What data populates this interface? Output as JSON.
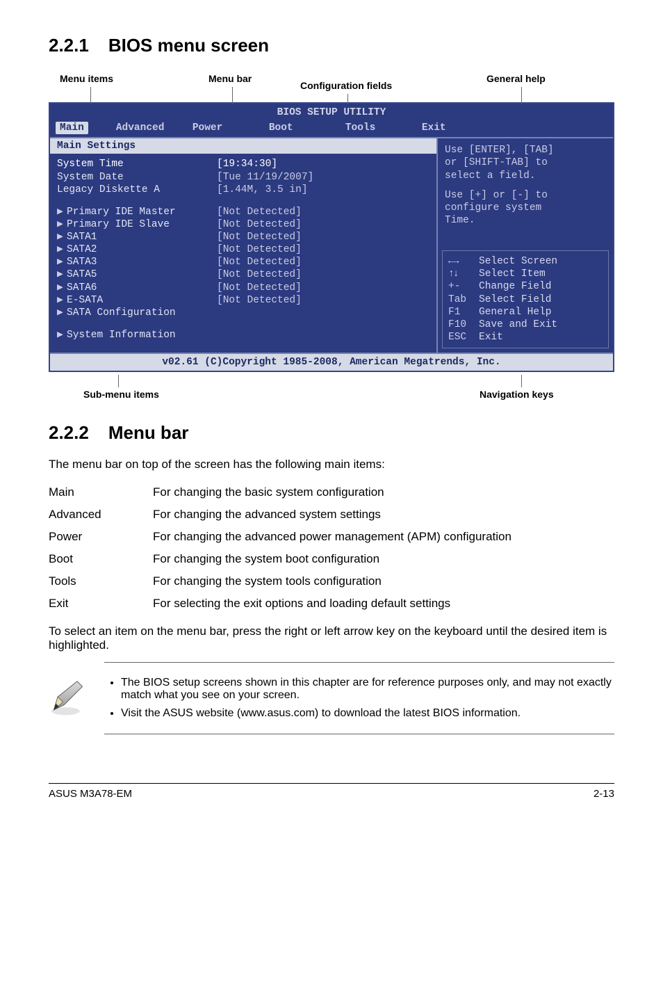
{
  "sec1": {
    "num": "2.2.1",
    "title": "BIOS menu screen"
  },
  "labels": {
    "menuitems": "Menu items",
    "menubar": "Menu bar",
    "conffields": "Configuration fields",
    "genhelp": "General help",
    "submenu": "Sub-menu items",
    "navkeys": "Navigation keys"
  },
  "bios": {
    "header": "BIOS SETUP UTILITY",
    "tabs": {
      "main": "Main",
      "advanced": "Advanced",
      "power": "Power",
      "boot": "Boot",
      "tools": "Tools",
      "exit": "Exit"
    },
    "section_title": "Main Settings",
    "rows": {
      "systime_k": "System Time",
      "systime_v": "[19:34:30]",
      "sysdate_k": "System Date",
      "sysdate_v": "[Tue 11/19/2007]",
      "legacy_k": "Legacy Diskette A",
      "legacy_v": "[1.44M, 3.5 in]",
      "pim_k": "Primary IDE Master",
      "pim_v": "[Not Detected]",
      "pis_k": "Primary IDE Slave",
      "pis_v": "[Not Detected]",
      "s1_k": "SATA1",
      "s1_v": "[Not Detected]",
      "s2_k": "SATA2",
      "s2_v": "[Not Detected]",
      "s3_k": "SATA3",
      "s3_v": "[Not Detected]",
      "s5_k": "SATA5",
      "s5_v": "[Not Detected]",
      "s6_k": "SATA6",
      "s6_v": "[Not Detected]",
      "es_k": "E-SATA",
      "es_v": "[Not Detected]",
      "sc_k": "SATA Configuration",
      "si_k": "System Information"
    },
    "help": {
      "l1": "Use [ENTER], [TAB]",
      "l2": "or [SHIFT-TAB] to",
      "l3": "select a field.",
      "l4": "Use [+] or [-] to",
      "l5": "configure system",
      "l6": "Time.",
      "nav": {
        "lr_k": "←→",
        "lr_v": "Select Screen",
        "ud_k": "↑↓",
        "ud_v": "Select Item",
        "pm_k": "+-",
        "pm_v": "Change Field",
        "tab_k": "Tab",
        "tab_v": "Select Field",
        "f1_k": "F1",
        "f1_v": "General Help",
        "f10_k": "F10",
        "f10_v": "Save and Exit",
        "esc_k": "ESC",
        "esc_v": "Exit"
      }
    },
    "footer": "v02.61 (C)Copyright 1985-2008, American Megatrends, Inc."
  },
  "sec2": {
    "num": "2.2.2",
    "title": "Menu bar"
  },
  "intro2": "The menu bar on top of the screen has the following main items:",
  "defs": {
    "main_t": "Main",
    "main_d": "For changing the basic system configuration",
    "adv_t": "Advanced",
    "adv_d": "For changing the advanced system settings",
    "pow_t": "Power",
    "pow_d": "For changing the advanced power management (APM) configuration",
    "boot_t": "Boot",
    "boot_d": "For changing the system boot configuration",
    "tools_t": "Tools",
    "tools_d": "For changing the system tools configuration",
    "exit_t": "Exit",
    "exit_d": "For selecting the exit options and loading default settings"
  },
  "para3": "To select an item on the menu bar, press the right or left arrow key on the keyboard until the desired item is highlighted.",
  "notes": {
    "n1": "The BIOS setup screens shown in this chapter are for reference purposes only, and may not exactly match what you see on your screen.",
    "n2": "Visit the ASUS website (www.asus.com) to download the latest BIOS information."
  },
  "pagefoot": {
    "left": "ASUS M3A78-EM",
    "right": "2-13"
  }
}
